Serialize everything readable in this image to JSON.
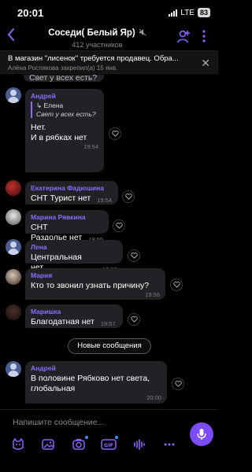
{
  "status": {
    "time": "20:01",
    "network": "LTE",
    "battery": "83"
  },
  "header": {
    "title": "Соседи( Белый Яр)",
    "subtitle": "412 участников"
  },
  "pinned": {
    "text": "В магазин \"лисенок\" требуется продавец. Обра...",
    "meta": "Алёна Рослякова закрепил(а) 15 янв."
  },
  "messages": {
    "partial": {
      "text": "Свет у всех есть?"
    },
    "m1": {
      "sender": "Андрей",
      "quote_name": "Елена",
      "quote_text": "Свет у всех есть?",
      "line1": "Нет.",
      "line2": "И в рябках нет",
      "time": "19:54"
    },
    "m2": {
      "sender": "Екатерина Фадюшина",
      "text": "СНТ Турист нет",
      "time": "19:54"
    },
    "m3": {
      "sender": "Марина Рявкина",
      "text": "СНТ Раздолье нет",
      "time": "19:55"
    },
    "m4": {
      "sender": "Лена",
      "text": "Центральная нет",
      "time": "19:55"
    },
    "m5": {
      "sender": "Мария",
      "text": "Кто то звонил узнать причину?",
      "time": "19:56"
    },
    "m6": {
      "sender": "Маришка",
      "text": "Благодатная нет",
      "time": "19:57"
    },
    "m7": {
      "sender": "Андрей",
      "line1": "В половине Рябково нет света,",
      "line2": "глобальная",
      "time": "20:00"
    }
  },
  "new_messages_label": "Новые сообщения",
  "composer": {
    "placeholder": "Напишите сообщение..."
  },
  "colors": {
    "accent": "#7c4dff",
    "sender": "#8a6dff",
    "bubble": "#222226",
    "background": "#000000"
  }
}
